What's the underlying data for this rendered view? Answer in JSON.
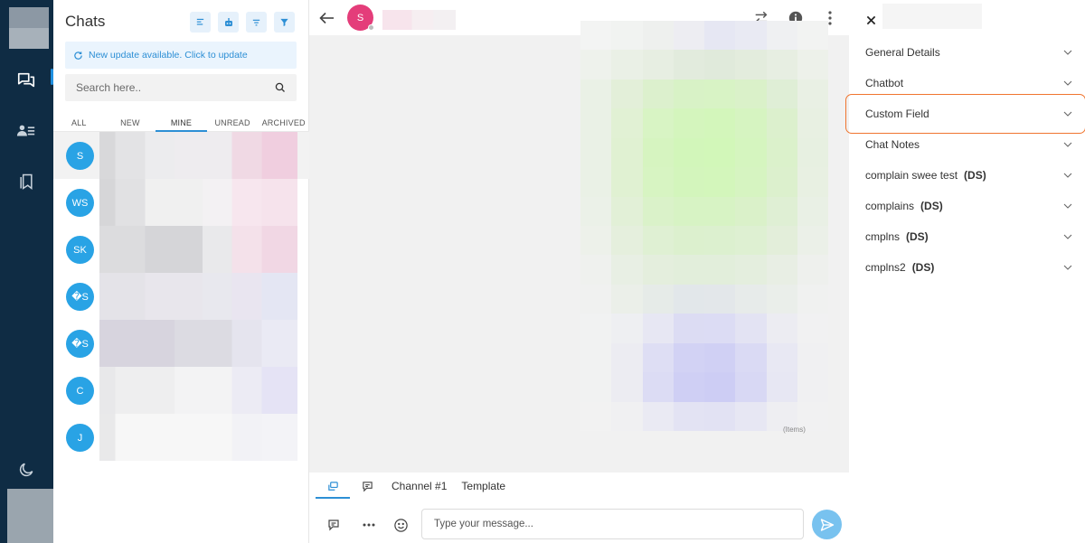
{
  "chat_list": {
    "title": "Chats",
    "update_notice": "New update available. Click to update",
    "search_placeholder": "Search here..",
    "tabs": [
      "ALL",
      "NEW",
      "MINE",
      "UNREAD",
      "ARCHIVED"
    ],
    "active_tab": "MINE",
    "items": [
      {
        "initials": "S"
      },
      {
        "initials": "WS"
      },
      {
        "initials": "SK"
      },
      {
        "initials": "�S"
      },
      {
        "initials": "�S"
      },
      {
        "initials": "C"
      },
      {
        "initials": "J"
      }
    ]
  },
  "conversation": {
    "contact_initial": "S",
    "message_caption": "(Items)",
    "composer": {
      "channel_label": "Channel #1",
      "template_label": "Template",
      "input_placeholder": "Type your message..."
    }
  },
  "details": {
    "sections": [
      {
        "label": "General Details",
        "tag": ""
      },
      {
        "label": "Chatbot",
        "tag": ""
      },
      {
        "label": "Custom Field",
        "tag": ""
      },
      {
        "label": "Chat Notes",
        "tag": ""
      },
      {
        "label": "complain swee test",
        "tag": "(DS)"
      },
      {
        "label": "complains",
        "tag": "(DS)"
      },
      {
        "label": "cmplns",
        "tag": "(DS)"
      },
      {
        "label": "cmplns2",
        "tag": "(DS)"
      }
    ],
    "highlighted": "Custom Field"
  },
  "colors": {
    "rail": "#0f2c44",
    "accent": "#2d8fd5",
    "avatar": "#29a3e5",
    "contact_avatar": "#e43d7a",
    "highlight": "#f0752f"
  }
}
